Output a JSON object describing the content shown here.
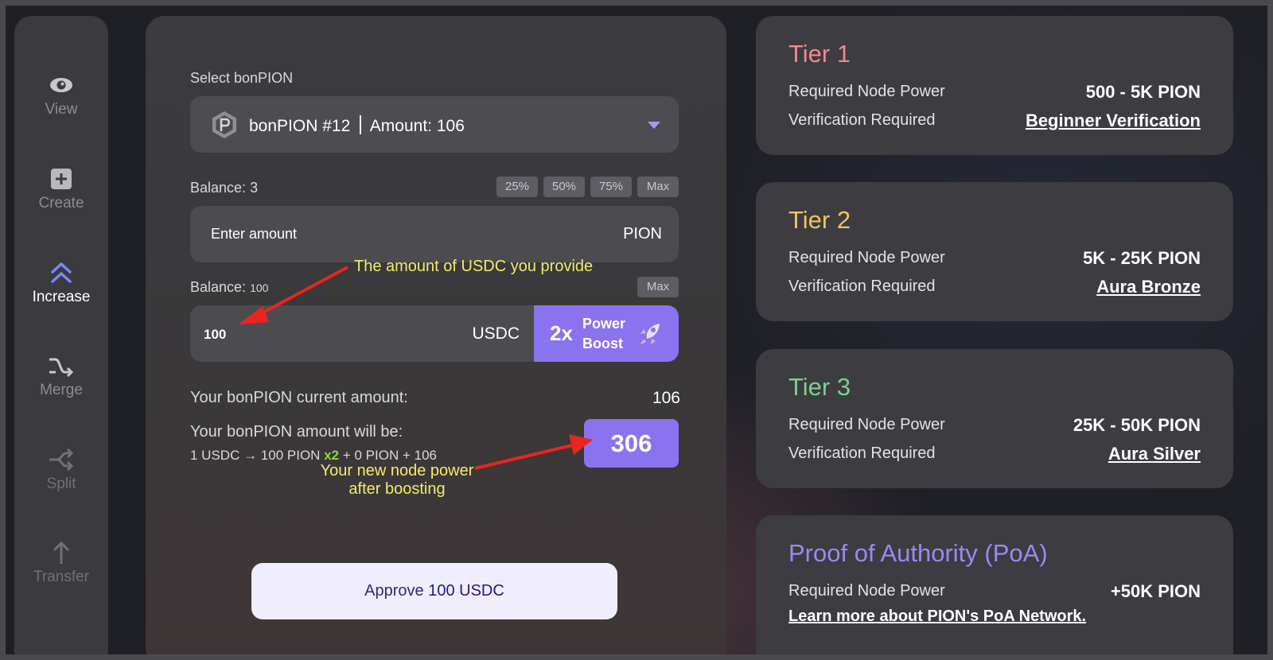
{
  "sidebar": {
    "items": [
      {
        "label": "View",
        "icon": "eye-icon"
      },
      {
        "label": "Create",
        "icon": "plus-square-icon"
      },
      {
        "label": "Increase",
        "icon": "double-chevron-up-icon"
      },
      {
        "label": "Merge",
        "icon": "merge-arrows-icon"
      },
      {
        "label": "Split",
        "icon": "split-arrows-icon"
      },
      {
        "label": "Transfer",
        "icon": "arrow-up-icon"
      }
    ],
    "active": "Increase"
  },
  "form": {
    "select_label": "Select bonPION",
    "selected_token": "bonPION #12",
    "selected_amount": "Amount: 106",
    "pion_balance_label": "Balance:",
    "pion_balance_value": "3",
    "percent_buttons": [
      "25%",
      "50%",
      "75%",
      "Max"
    ],
    "pion_placeholder": "Enter amount",
    "pion_unit": "PION",
    "usdc_balance_label": "Balance:",
    "usdc_balance_value": "100",
    "usdc_max": "Max",
    "usdc_value": "100",
    "usdc_unit": "USDC",
    "boost_multiplier": "2x",
    "boost_line1": "Power",
    "boost_line2": "Boost",
    "current_label": "Your bonPION current amount:",
    "current_value": "106",
    "will_be_label": "Your bonPION amount will be:",
    "formula_a": "1 USDC → 100 PION",
    "formula_mult": "x2",
    "formula_b": "+ 0 PION + 106",
    "result_value": "306",
    "approve_prefix": "Approve",
    "approve_amount": "100 USDC"
  },
  "annotations": {
    "usdc_note": "The amount of USDC you provide",
    "result_note_line1": "Your new node power",
    "result_note_line2": "after boosting",
    "color": "#f2ec6c",
    "arrow_color": "#e8251f"
  },
  "tiers": [
    {
      "title": "Tier 1",
      "color": "#f08a8a",
      "power_label": "Required Node Power",
      "power": "500 - 5K PION",
      "verify_label": "Verification Required",
      "verify": "Beginner Verification"
    },
    {
      "title": "Tier 2",
      "color": "#f2c460",
      "power_label": "Required Node Power",
      "power": "5K - 25K PION",
      "verify_label": "Verification Required",
      "verify": "Aura Bronze"
    },
    {
      "title": "Tier 3",
      "color": "#7ed08c",
      "power_label": "Required Node Power",
      "power": "25K - 50K PION",
      "verify_label": "Verification Required",
      "verify": "Aura Silver"
    },
    {
      "title": "Proof of Authority (PoA)",
      "color": "#9a8af0",
      "power_label": "Required Node Power",
      "power": "+50K PION",
      "link": "Learn more about PION's PoA Network."
    }
  ],
  "colors": {
    "accent": "#8a73ee",
    "panel": "#3a3a3f",
    "background": "#1f1f26"
  }
}
